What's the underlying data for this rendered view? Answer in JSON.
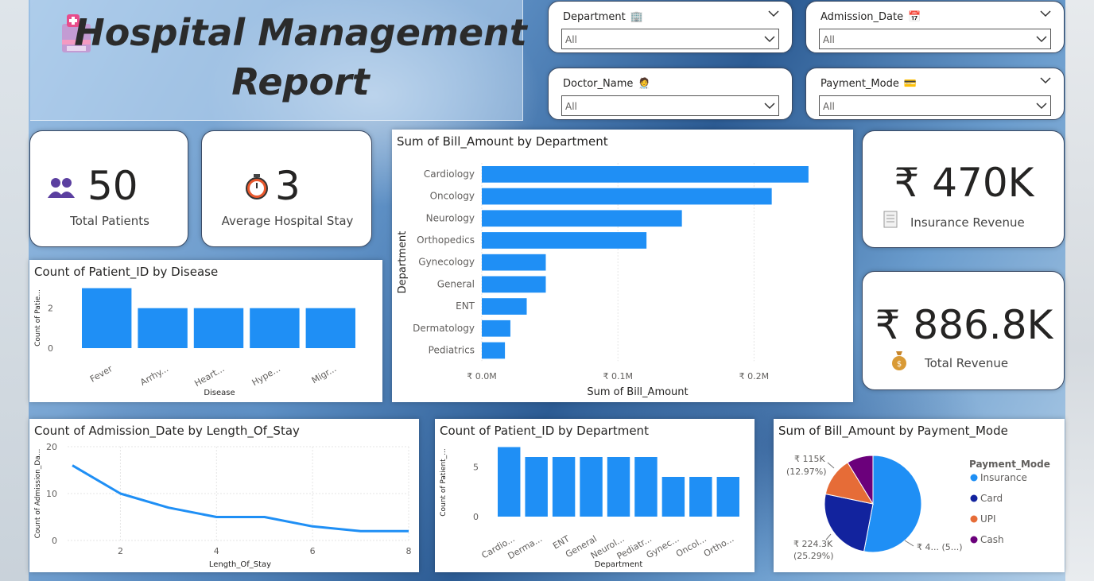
{
  "title": "Hospital Management Report",
  "slicers": [
    {
      "label": "Department",
      "icon": "🏢",
      "value": "All"
    },
    {
      "label": "Admission_Date",
      "icon": "📅",
      "value": "All"
    },
    {
      "label": "Doctor_Name",
      "icon": "🧑‍⚕️",
      "value": "All"
    },
    {
      "label": "Payment_Mode",
      "icon": "💳",
      "value": "All"
    }
  ],
  "kpis": {
    "total_patients": {
      "value": "50",
      "label": "Total Patients"
    },
    "avg_stay": {
      "value": "3",
      "label": "Average Hospital Stay"
    },
    "insurance_revenue": {
      "value": "₹ 470K",
      "label": "Insurance Revenue"
    },
    "total_revenue": {
      "value": "₹ 886.8K",
      "label": "Total Revenue"
    }
  },
  "chart_data": [
    {
      "id": "dept_bill",
      "type": "bar",
      "orientation": "horizontal",
      "title": "Sum of Bill_Amount by Department",
      "xlabel": "Sum of Bill_Amount",
      "ylabel": "Department",
      "categories": [
        "Cardiology",
        "Oncology",
        "Neurology",
        "Orthopedics",
        "Gynecology",
        "General",
        "ENT",
        "Dermatology",
        "Pediatrics"
      ],
      "values": [
        0.24,
        0.213,
        0.147,
        0.121,
        0.047,
        0.047,
        0.033,
        0.021,
        0.017
      ],
      "xticks": [
        "₹ 0.0M",
        "₹ 0.1M",
        "₹ 0.2M"
      ],
      "xlim": [
        0,
        0.25
      ],
      "color": "#1f8ff5"
    },
    {
      "id": "disease",
      "type": "bar",
      "title": "Count of Patient_ID by Disease",
      "xlabel": "Disease",
      "ylabel": "Count of Patie...",
      "categories": [
        "Fever",
        "Arrhy...",
        "Heart...",
        "Hype...",
        "Migr..."
      ],
      "values": [
        3,
        2,
        2,
        2,
        2
      ],
      "yticks": [
        "0",
        "2"
      ],
      "ylim": [
        0,
        3.3
      ],
      "color": "#1f8ff5"
    },
    {
      "id": "stay",
      "type": "line",
      "title": "Count of Admission_Date by Length_Of_Stay",
      "xlabel": "Length_Of_Stay",
      "ylabel": "Count of Admission_Da...",
      "x": [
        1,
        2,
        3,
        4,
        5,
        6,
        7,
        8
      ],
      "values": [
        16,
        10,
        7,
        5,
        5,
        3,
        2,
        2
      ],
      "xticks": [
        "2",
        "4",
        "6",
        "8"
      ],
      "yticks": [
        "0",
        "10",
        "20"
      ],
      "xlim": [
        0.9,
        8
      ],
      "ylim": [
        0,
        20
      ],
      "color": "#1f8ff5"
    },
    {
      "id": "dept_count",
      "type": "bar",
      "title": "Count of Patient_ID by Department",
      "xlabel": "Department",
      "ylabel": "Count of Patient_...",
      "categories": [
        "Cardio...",
        "Derma...",
        "ENT",
        "General",
        "Neurol...",
        "Pediatr...",
        "Gynec...",
        "Oncol...",
        "Ortho..."
      ],
      "values": [
        7,
        6,
        6,
        6,
        6,
        6,
        4,
        4,
        4
      ],
      "yticks": [
        "0",
        "5"
      ],
      "ylim": [
        0,
        7.6
      ],
      "color": "#1f8ff5"
    },
    {
      "id": "payment",
      "type": "pie",
      "title": "Sum of Bill_Amount by Payment_Mode",
      "legend_title": "Payment_Mode",
      "legend_position": "right",
      "slices": [
        {
          "name": "Insurance",
          "value": 470.0,
          "pct": 53.0,
          "label": "₹ 4... (5...)",
          "color": "#1f8ff5"
        },
        {
          "name": "Card",
          "value": 224.3,
          "pct": 25.29,
          "label": "₹ 224.3K (25.29%)",
          "color": "#12239e"
        },
        {
          "name": "UPI",
          "value": 115.0,
          "pct": 12.97,
          "label": "₹ 115K (12.97%)",
          "color": "#e66c37"
        },
        {
          "name": "Cash",
          "value": 77.5,
          "pct": 8.74,
          "label": "",
          "color": "#6b007b"
        }
      ]
    }
  ]
}
